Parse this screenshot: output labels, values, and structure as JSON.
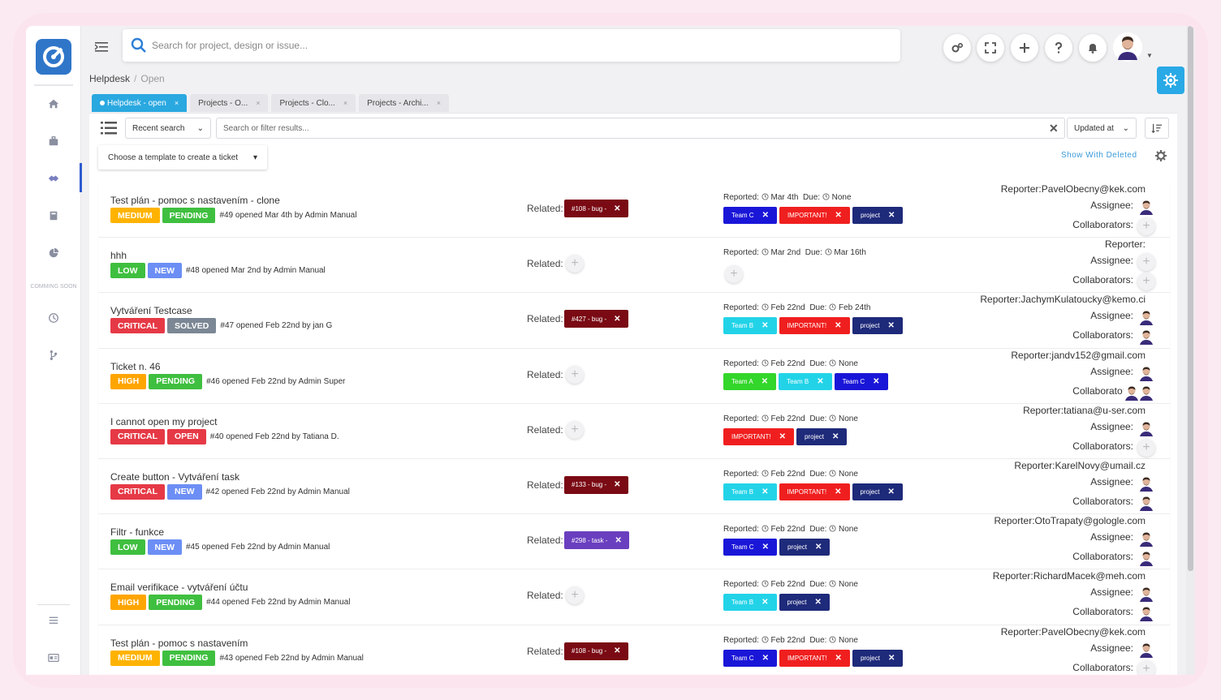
{
  "search": {
    "placeholder": "Search for project, design or issue..."
  },
  "breadcrumb": {
    "root": "Helpdesk",
    "current": "Open"
  },
  "sidebar": {
    "coming_soon": "COMMING SOON"
  },
  "tabs": [
    {
      "label": "Helpdesk - open",
      "active": true
    },
    {
      "label": "Projects - O...",
      "active": false
    },
    {
      "label": "Projects - Clo...",
      "active": false
    },
    {
      "label": "Projects - Archi...",
      "active": false
    }
  ],
  "filterbar": {
    "recent_search": "Recent search",
    "filter_placeholder": "Search or filter results...",
    "sort": "Updated at"
  },
  "toolbar": {
    "template": "Choose a template to create a ticket",
    "show_deleted": "Show With Deleted"
  },
  "labels": {
    "related": "Related:",
    "reported": "Reported:",
    "due": "Due:",
    "reporter": "Reporter:",
    "assignee": "Assignee:",
    "collaborators": "Collaborators:"
  },
  "colors": {
    "medium": "#ffb300",
    "pending": "#3fbf3f",
    "low": "#3fbf3f",
    "new": "#6c8ef5",
    "critical": "#e63946",
    "solved": "#7b8794",
    "high": "#ffa500",
    "open": "#e63946",
    "bug": "#7a0a14",
    "task": "#6a3fbf",
    "teamC": "#1a16d8",
    "teamB": "#22d3e8",
    "teamA": "#33d62a",
    "important": "#f01f1f",
    "project": "#1e2a7a",
    "accent": "#2aa8e0"
  },
  "tickets": [
    {
      "title": "Test plán - pomoc s nastavením - clone",
      "priority": "MEDIUM",
      "priority_color": "#ffb300",
      "status": "PENDING",
      "status_color": "#3fbf3f",
      "meta": "#49 opened Mar 4th by Admin Manual",
      "related": "#108 - bug -",
      "related_color": "#7a0a14",
      "reported": "Mar 4th",
      "due": "None",
      "tags": [
        {
          "label": "Team C",
          "color": "#1a16d8"
        },
        {
          "label": "IMPORTANT!",
          "color": "#f01f1f"
        },
        {
          "label": "project",
          "color": "#1e2a7a"
        }
      ],
      "reporter": "PavelObecny@kek.com",
      "assignee": 1,
      "collaborators": 0
    },
    {
      "title": "hhh",
      "priority": "LOW",
      "priority_color": "#3fbf3f",
      "status": "NEW",
      "status_color": "#6c8ef5",
      "meta": "#48 opened Mar 2nd by Admin Manual",
      "related": "",
      "related_color": "",
      "reported": "Mar 2nd",
      "due": "Mar 16th",
      "tags": [],
      "reporter": "",
      "assignee": 0,
      "collaborators": 0
    },
    {
      "title": "Vytváření Testcase",
      "priority": "CRITICAL",
      "priority_color": "#e63946",
      "status": "SOLVED",
      "status_color": "#7b8794",
      "meta": "#47 opened Feb 22nd by jan G",
      "related": "#427 - bug -",
      "related_color": "#7a0a14",
      "reported": "Feb 22nd",
      "due": "Feb 24th",
      "tags": [
        {
          "label": "Team B",
          "color": "#22d3e8"
        },
        {
          "label": "IMPORTANT!",
          "color": "#f01f1f"
        },
        {
          "label": "project",
          "color": "#1e2a7a"
        }
      ],
      "reporter": "JachymKulatoucky@kemo.ci",
      "assignee": 1,
      "collaborators": 1
    },
    {
      "title": "Ticket n. 46",
      "priority": "HIGH",
      "priority_color": "#ffa500",
      "status": "PENDING",
      "status_color": "#3fbf3f",
      "meta": "#46 opened Feb 22nd by Admin Super",
      "related": "",
      "related_color": "",
      "reported": "Feb 22nd",
      "due": "None",
      "tags": [
        {
          "label": "Team A",
          "color": "#33d62a"
        },
        {
          "label": "Team B",
          "color": "#22d3e8"
        },
        {
          "label": "Team C",
          "color": "#1a16d8"
        }
      ],
      "reporter": "jandv152@gmail.com",
      "assignee": 1,
      "collaborators": 2
    },
    {
      "title": "I cannot open my project",
      "priority": "CRITICAL",
      "priority_color": "#e63946",
      "status": "OPEN",
      "status_color": "#e63946",
      "meta": "#40 opened Feb 22nd by Tatiana D.",
      "related": "",
      "related_color": "",
      "reported": "Feb 22nd",
      "due": "None",
      "tags": [
        {
          "label": "IMPORTANT!",
          "color": "#f01f1f"
        },
        {
          "label": "project",
          "color": "#1e2a7a"
        }
      ],
      "reporter": "tatiana@u-ser.com",
      "assignee": 1,
      "collaborators": 0
    },
    {
      "title": "Create button - Vytváření task",
      "priority": "CRITICAL",
      "priority_color": "#e63946",
      "status": "NEW",
      "status_color": "#6c8ef5",
      "meta": "#42 opened Feb 22nd by Admin Manual",
      "related": "#133 - bug -",
      "related_color": "#7a0a14",
      "reported": "Feb 22nd",
      "due": "None",
      "tags": [
        {
          "label": "Team B",
          "color": "#22d3e8"
        },
        {
          "label": "IMPORTANT!",
          "color": "#f01f1f"
        },
        {
          "label": "project",
          "color": "#1e2a7a"
        }
      ],
      "reporter": "KarelNovy@umail.cz",
      "assignee": 1,
      "collaborators": 1
    },
    {
      "title": "Filtr - funkce",
      "priority": "LOW",
      "priority_color": "#3fbf3f",
      "status": "NEW",
      "status_color": "#6c8ef5",
      "meta": "#45 opened Feb 22nd by Admin Manual",
      "related": "#298 - task -",
      "related_color": "#6a3fbf",
      "reported": "Feb 22nd",
      "due": "None",
      "tags": [
        {
          "label": "Team C",
          "color": "#1a16d8"
        },
        {
          "label": "project",
          "color": "#1e2a7a"
        }
      ],
      "reporter": "OtoTrapaty@gologle.com",
      "assignee": 1,
      "collaborators": 1
    },
    {
      "title": "Email verifikace - vytváření účtu",
      "priority": "HIGH",
      "priority_color": "#ffa500",
      "status": "PENDING",
      "status_color": "#3fbf3f",
      "meta": "#44 opened Feb 22nd by Admin Manual",
      "related": "",
      "related_color": "",
      "reported": "Feb 22nd",
      "due": "None",
      "tags": [
        {
          "label": "Team B",
          "color": "#22d3e8"
        },
        {
          "label": "project",
          "color": "#1e2a7a"
        }
      ],
      "reporter": "RichardMacek@meh.com",
      "assignee": 1,
      "collaborators": 1
    },
    {
      "title": "Test plán - pomoc s nastavením",
      "priority": "MEDIUM",
      "priority_color": "#ffb300",
      "status": "PENDING",
      "status_color": "#3fbf3f",
      "meta": "#43 opened Feb 22nd by Admin Manual",
      "related": "#108 - bug -",
      "related_color": "#7a0a14",
      "reported": "Feb 22nd",
      "due": "None",
      "tags": [
        {
          "label": "Team C",
          "color": "#1a16d8"
        },
        {
          "label": "IMPORTANT!",
          "color": "#f01f1f"
        },
        {
          "label": "project",
          "color": "#1e2a7a"
        }
      ],
      "reporter": "PavelObecny@kek.com",
      "assignee": 1,
      "collaborators": 0
    }
  ]
}
